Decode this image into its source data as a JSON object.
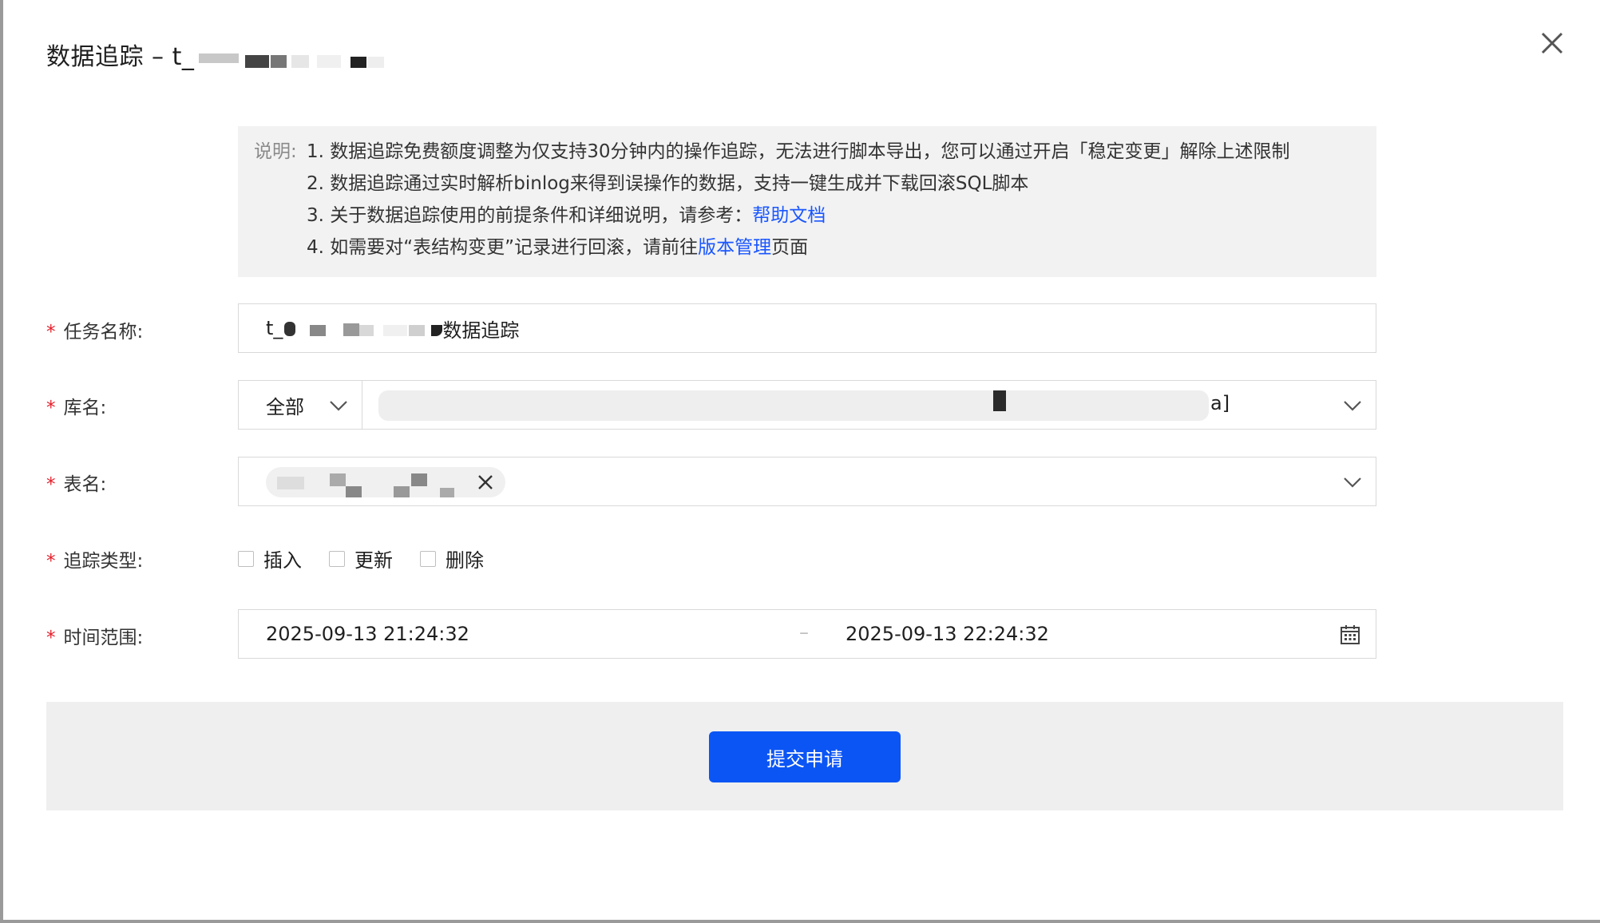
{
  "dialog": {
    "title": "数据追踪 – t_",
    "close_icon": "close-icon"
  },
  "notice": {
    "label": "说明:",
    "line1": "1. 数据追踪免费额度调整为仅支持30分钟内的操作追踪，无法进行脚本导出，您可以通过开启「稳定变更」解除上述限制",
    "line2": "2. 数据追踪通过实时解析binlog来得到误操作的数据，支持一键生成并下载回滚SQL脚本",
    "line3_prefix": "3. 关于数据追踪使用的前提条件和详细说明，请参考：",
    "line3_link": "帮助文档",
    "line4_prefix": "4. 如需要对“表结构变更”记录进行回滚，请前往",
    "line4_link": "版本管理",
    "line4_suffix": "页面"
  },
  "form": {
    "required_mark": "*",
    "task_name": {
      "label": "任务名称:",
      "value_prefix": "t_",
      "value_suffix": "数据追踪"
    },
    "db_name": {
      "label": "库名:",
      "scope": "全部",
      "value_suffix": "a]"
    },
    "table_name": {
      "label": "表名:"
    },
    "track_type": {
      "label": "追踪类型:",
      "options": [
        "插入",
        "更新",
        "删除"
      ]
    },
    "time_range": {
      "label": "时间范围:",
      "start": "2025-09-13 21:24:32",
      "separator": "–",
      "end": "2025-09-13 22:24:32"
    }
  },
  "footer": {
    "submit_label": "提交申请"
  },
  "colors": {
    "primary": "#0b55f5",
    "required": "#e5202b",
    "link": "#1a56ff"
  }
}
